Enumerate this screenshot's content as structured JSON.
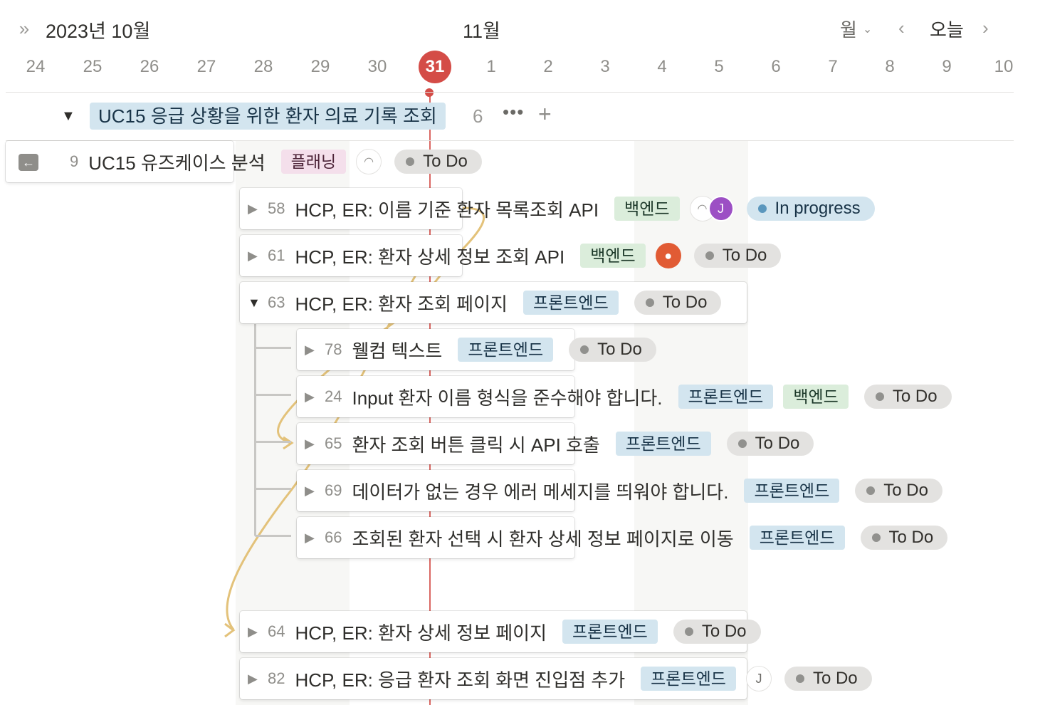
{
  "header": {
    "month_label": "2023년 10월",
    "next_month_label": "11월",
    "view_label": "월",
    "today_label": "오늘"
  },
  "days": [
    "24",
    "25",
    "26",
    "27",
    "28",
    "29",
    "30",
    "31",
    "1",
    "2",
    "3",
    "4",
    "5",
    "6",
    "7",
    "8",
    "9",
    "10"
  ],
  "today": "31",
  "group": {
    "label": "UC15 응급 상황을 위한 환자 의료 기록 조회",
    "count": "6",
    "more": "•••",
    "add": "+"
  },
  "rows": [
    {
      "num": "9",
      "title": "UC15 유즈케이스 분석",
      "tags": [
        "플래닝"
      ],
      "status": "To Do"
    },
    {
      "num": "58",
      "title": "HCP, ER: 이름 기준 환자 목록조회 API",
      "tags": [
        "백엔드"
      ],
      "avatar_initial": "J",
      "status": "In progress"
    },
    {
      "num": "61",
      "title": "HCP, ER: 환자 상세 정보 조회 API",
      "tags": [
        "백엔드"
      ],
      "status": "To Do"
    },
    {
      "num": "63",
      "title": "HCP, ER: 환자 조회 페이지",
      "tags": [
        "프론트엔드"
      ],
      "status": "To Do"
    },
    {
      "num": "78",
      "title": "웰컴 텍스트",
      "tags": [
        "프론트엔드"
      ],
      "status": "To Do"
    },
    {
      "num": "24",
      "title": "Input 환자 이름 형식을 준수해야 합니다.",
      "tags": [
        "프론트엔드",
        "백엔드"
      ],
      "status": "To Do"
    },
    {
      "num": "65",
      "title": "환자 조회 버튼 클릭 시 API 호출",
      "tags": [
        "프론트엔드"
      ],
      "status": "To Do"
    },
    {
      "num": "69",
      "title": "데이터가 없는 경우 에러 메세지를 띄워야 합니다.",
      "tags": [
        "프론트엔드"
      ],
      "status": "To Do"
    },
    {
      "num": "66",
      "title": "조회된 환자 선택 시 환자 상세 정보 페이지로 이동",
      "tags": [
        "프론트엔드"
      ],
      "status": "To Do"
    },
    {
      "num": "64",
      "title": "HCP, ER: 환자 상세 정보 페이지",
      "tags": [
        "프론트엔드"
      ],
      "status": "To Do"
    },
    {
      "num": "82",
      "title": "HCP, ER: 응급 환자 조회 화면 진입점 추가",
      "tags": [
        "프론트엔드"
      ],
      "avatar_initial": "J",
      "status": "To Do"
    }
  ],
  "colors": {
    "today_red": "#d44c47",
    "dependency_line": "#e3c27a"
  }
}
